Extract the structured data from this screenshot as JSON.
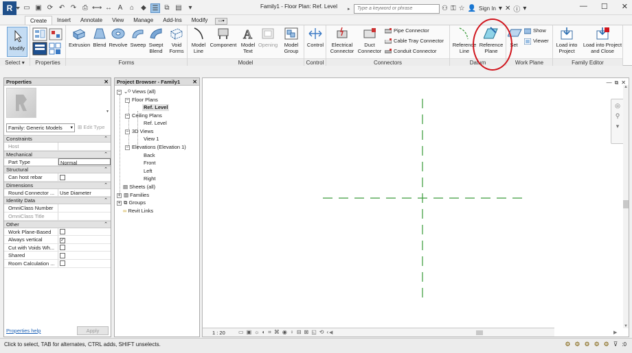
{
  "window": {
    "title": "Family1 - Floor Plan: Ref. Level",
    "search_placeholder": "Type a keyword or phrase",
    "sign_in": "Sign In",
    "app_logo": "R"
  },
  "tabs": [
    {
      "label": "Create",
      "active": true
    },
    {
      "label": "Insert"
    },
    {
      "label": "Annotate"
    },
    {
      "label": "View"
    },
    {
      "label": "Manage"
    },
    {
      "label": "Add-Ins"
    },
    {
      "label": "Modify"
    }
  ],
  "ribbon": {
    "select": {
      "modify": "Modify",
      "panel": "Select"
    },
    "properties": {
      "panel": "Properties"
    },
    "forms": {
      "panel": "Forms",
      "tools": [
        "Extrusion",
        "Blend",
        "Revolve",
        "Sweep",
        "Swept Blend",
        "Void Forms"
      ]
    },
    "model": {
      "panel": "Model",
      "tools": [
        "Model Line",
        "Component",
        "Model Text",
        "Opening",
        "Model Group"
      ]
    },
    "control": {
      "panel": "Control",
      "tool": "Control"
    },
    "connectors": {
      "panel": "Connectors",
      "electrical": "Electrical Connector",
      "duct": "Duct Connector",
      "pipe": "Pipe  Connector",
      "cable": "Cable Tray  Connector",
      "conduit": "Conduit  Connector"
    },
    "datum": {
      "panel": "Datum",
      "ref_line": "Reference Line",
      "ref_plane": "Reference Plane"
    },
    "workplane": {
      "panel": "Work Plane",
      "set": "Set",
      "show": "Show",
      "viewer": "Viewer"
    },
    "family_editor": {
      "panel": "Family Editor",
      "load": "Load into Project",
      "load_close": "Load into Project and Close"
    }
  },
  "properties_palette": {
    "title": "Properties",
    "family_select": "Family: Generic Models",
    "edit_type": "Edit Type",
    "sections": [
      {
        "name": "Constraints",
        "rows": [
          {
            "k": "Host",
            "v": "",
            "dim": true
          }
        ]
      },
      {
        "name": "Mechanical",
        "rows": [
          {
            "k": "Part Type",
            "v": "Normal",
            "boxed": true
          }
        ]
      },
      {
        "name": "Structural",
        "rows": [
          {
            "k": "Can host rebar",
            "check": false
          }
        ]
      },
      {
        "name": "Dimensions",
        "rows": [
          {
            "k": "Round Connector ...",
            "v": "Use Diameter"
          }
        ]
      },
      {
        "name": "Identity Data",
        "rows": [
          {
            "k": "OmniClass Number",
            "v": ""
          },
          {
            "k": "OmniClass Title",
            "v": "",
            "dim": true
          }
        ]
      },
      {
        "name": "Other",
        "rows": [
          {
            "k": "Work Plane-Based",
            "check": false
          },
          {
            "k": "Always vertical",
            "check": true
          },
          {
            "k": "Cut with Voids Wh...",
            "check": false
          },
          {
            "k": "Shared",
            "check": false
          },
          {
            "k": "Room Calculation ...",
            "check": false
          }
        ]
      }
    ],
    "help": "Properties help",
    "apply": "Apply"
  },
  "project_browser": {
    "title": "Project Browser - Family1",
    "items": {
      "views": "Views (all)",
      "floor_plans": "Floor Plans",
      "fp_ref_level": "Ref. Level",
      "ceiling_plans": "Ceiling Plans",
      "cp_ref_level": "Ref. Level",
      "views_3d": "3D Views",
      "view1": "View 1",
      "elevations": "Elevations (Elevation 1)",
      "back": "Back",
      "front": "Front",
      "left": "Left",
      "right": "Right",
      "sheets": "Sheets (all)",
      "families": "Families",
      "groups": "Groups",
      "links": "Revit Links"
    }
  },
  "view": {
    "scale": "1 : 20",
    "ref_plane_color": "#3a9b3a"
  },
  "status": {
    "text": "Click to select, TAB for alternates, CTRL adds, SHIFT unselects.",
    "filter_count": ":0"
  },
  "colors": {
    "highlight_circle": "#d0141c",
    "selection_blue": "#c4dcf3"
  }
}
